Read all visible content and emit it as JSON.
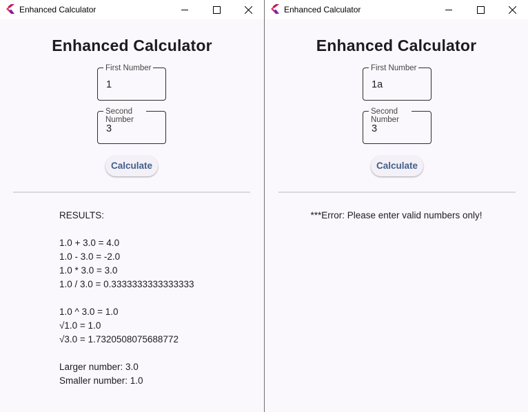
{
  "windows": [
    {
      "title": "Enhanced Calculator",
      "heading": "Enhanced Calculator",
      "fields": [
        {
          "label": "First Number",
          "value": "1"
        },
        {
          "label": "Second Number",
          "value": "3"
        }
      ],
      "button_label": "Calculate",
      "results": {
        "header": "RESULTS:",
        "basic": [
          "1.0 + 3.0 = 4.0",
          "1.0 - 3.0 = -2.0",
          "1.0 * 3.0 = 3.0",
          "1.0 / 3.0 = 0.3333333333333333"
        ],
        "advanced": [
          "1.0 ^ 3.0 = 1.0",
          "√1.0 = 1.0",
          "√3.0 = 1.7320508075688772"
        ],
        "compare": [
          "Larger number: 3.0",
          "Smaller number: 1.0"
        ]
      }
    },
    {
      "title": "Enhanced Calculator",
      "heading": "Enhanced Calculator",
      "fields": [
        {
          "label": "First Number",
          "value": "1a"
        },
        {
          "label": "Second Number",
          "value": "3"
        }
      ],
      "button_label": "Calculate",
      "error": "***Error: Please enter valid numbers only!"
    }
  ],
  "colors": {
    "window_bg": "#fbf8fd",
    "button_text": "#3f5f8a",
    "button_bg": "#f4f0f7",
    "divider": "#d9d9dc"
  },
  "icons": [
    "flutter-app-icon",
    "minimize-icon",
    "maximize-icon",
    "close-icon"
  ]
}
